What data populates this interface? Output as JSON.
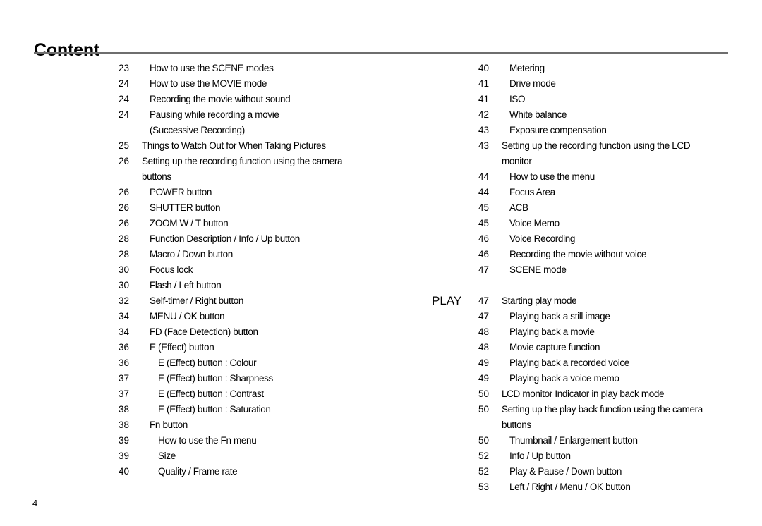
{
  "header": {
    "title": "Content"
  },
  "footer": {
    "page_number": "4"
  },
  "sections": {
    "play_label": "PLAY"
  },
  "left_column": [
    {
      "page": "23",
      "label": "How to use the SCENE modes",
      "level": 1
    },
    {
      "page": "24",
      "label": "How to use the MOVIE mode",
      "level": 1
    },
    {
      "page": "24",
      "label": "Recording the movie without sound",
      "level": 1
    },
    {
      "page": "24",
      "label": "Pausing while recording a movie",
      "level": 1
    },
    {
      "page": "",
      "label": "(Successive Recording)",
      "level": 1,
      "continuation": true
    },
    {
      "page": "25",
      "label": "Things to Watch Out for When Taking Pictures",
      "level": 0
    },
    {
      "page": "26",
      "label": "Setting up the recording function using the camera",
      "level": 0
    },
    {
      "page": "",
      "label": "buttons",
      "level": 0,
      "continuation": true
    },
    {
      "page": "26",
      "label": "POWER button",
      "level": 1
    },
    {
      "page": "26",
      "label": "SHUTTER button",
      "level": 1
    },
    {
      "page": "26",
      "label": "ZOOM W / T button",
      "level": 1
    },
    {
      "page": "28",
      "label": "Function Description / Info / Up button",
      "level": 1
    },
    {
      "page": "28",
      "label": "Macro / Down button",
      "level": 1
    },
    {
      "page": "30",
      "label": "Focus lock",
      "level": 1
    },
    {
      "page": "30",
      "label": "Flash / Left button",
      "level": 1
    },
    {
      "page": "32",
      "label": "Self-timer / Right button",
      "level": 1
    },
    {
      "page": "34",
      "label": "MENU / OK button",
      "level": 1
    },
    {
      "page": "34",
      "label": "FD (Face Detection) button",
      "level": 1
    },
    {
      "page": "36",
      "label": "E (Effect) button",
      "level": 1
    },
    {
      "page": "36",
      "label": "E (Effect) button : Colour",
      "level": 2
    },
    {
      "page": "37",
      "label": "E (Effect) button : Sharpness",
      "level": 2
    },
    {
      "page": "37",
      "label": "E (Effect) button : Contrast",
      "level": 2
    },
    {
      "page": "38",
      "label": "E (Effect) button : Saturation",
      "level": 2
    },
    {
      "page": "38",
      "label": "Fn button",
      "level": 1
    },
    {
      "page": "39",
      "label": "How to use the Fn menu",
      "level": 2
    },
    {
      "page": "39",
      "label": "Size",
      "level": 2
    },
    {
      "page": "40",
      "label": "Quality / Frame rate",
      "level": 2
    }
  ],
  "right_column": [
    {
      "page": "40",
      "label": "Metering",
      "level": 1
    },
    {
      "page": "41",
      "label": "Drive mode",
      "level": 1
    },
    {
      "page": "41",
      "label": "ISO",
      "level": 1
    },
    {
      "page": "42",
      "label": "White balance",
      "level": 1
    },
    {
      "page": "43",
      "label": "Exposure compensation",
      "level": 1
    },
    {
      "page": "43",
      "label": "Setting up the recording function using the LCD",
      "level": 0
    },
    {
      "page": "",
      "label": "monitor",
      "level": 0,
      "continuation": true
    },
    {
      "page": "44",
      "label": "How to use the menu",
      "level": 1
    },
    {
      "page": "44",
      "label": "Focus Area",
      "level": 1
    },
    {
      "page": "45",
      "label": "ACB",
      "level": 1
    },
    {
      "page": "45",
      "label": "Voice Memo",
      "level": 1
    },
    {
      "page": "46",
      "label": "Voice Recording",
      "level": 1
    },
    {
      "page": "46",
      "label": "Recording the movie without voice",
      "level": 1
    },
    {
      "page": "47",
      "label": "SCENE mode",
      "level": 1
    },
    {
      "page": "",
      "label": "",
      "level": 0,
      "spacer": true
    },
    {
      "page": "47",
      "label": "Starting play mode",
      "level": 0,
      "section": "PLAY"
    },
    {
      "page": "47",
      "label": "Playing back a still image",
      "level": 1
    },
    {
      "page": "48",
      "label": "Playing back a movie",
      "level": 1
    },
    {
      "page": "48",
      "label": "Movie capture function",
      "level": 1
    },
    {
      "page": "49",
      "label": "Playing back a recorded voice",
      "level": 1
    },
    {
      "page": "49",
      "label": "Playing back a voice memo",
      "level": 1
    },
    {
      "page": "50",
      "label": "LCD monitor Indicator in play back mode",
      "level": 0
    },
    {
      "page": "50",
      "label": "Setting up the play back function using the camera",
      "level": 0
    },
    {
      "page": "",
      "label": "buttons",
      "level": 0,
      "continuation": true
    },
    {
      "page": "50",
      "label": "Thumbnail / Enlargement button",
      "level": 1
    },
    {
      "page": "52",
      "label": "Info / Up button",
      "level": 1
    },
    {
      "page": "52",
      "label": "Play & Pause / Down button",
      "level": 1
    },
    {
      "page": "53",
      "label": "Left / Right / Menu / OK button",
      "level": 1
    }
  ]
}
